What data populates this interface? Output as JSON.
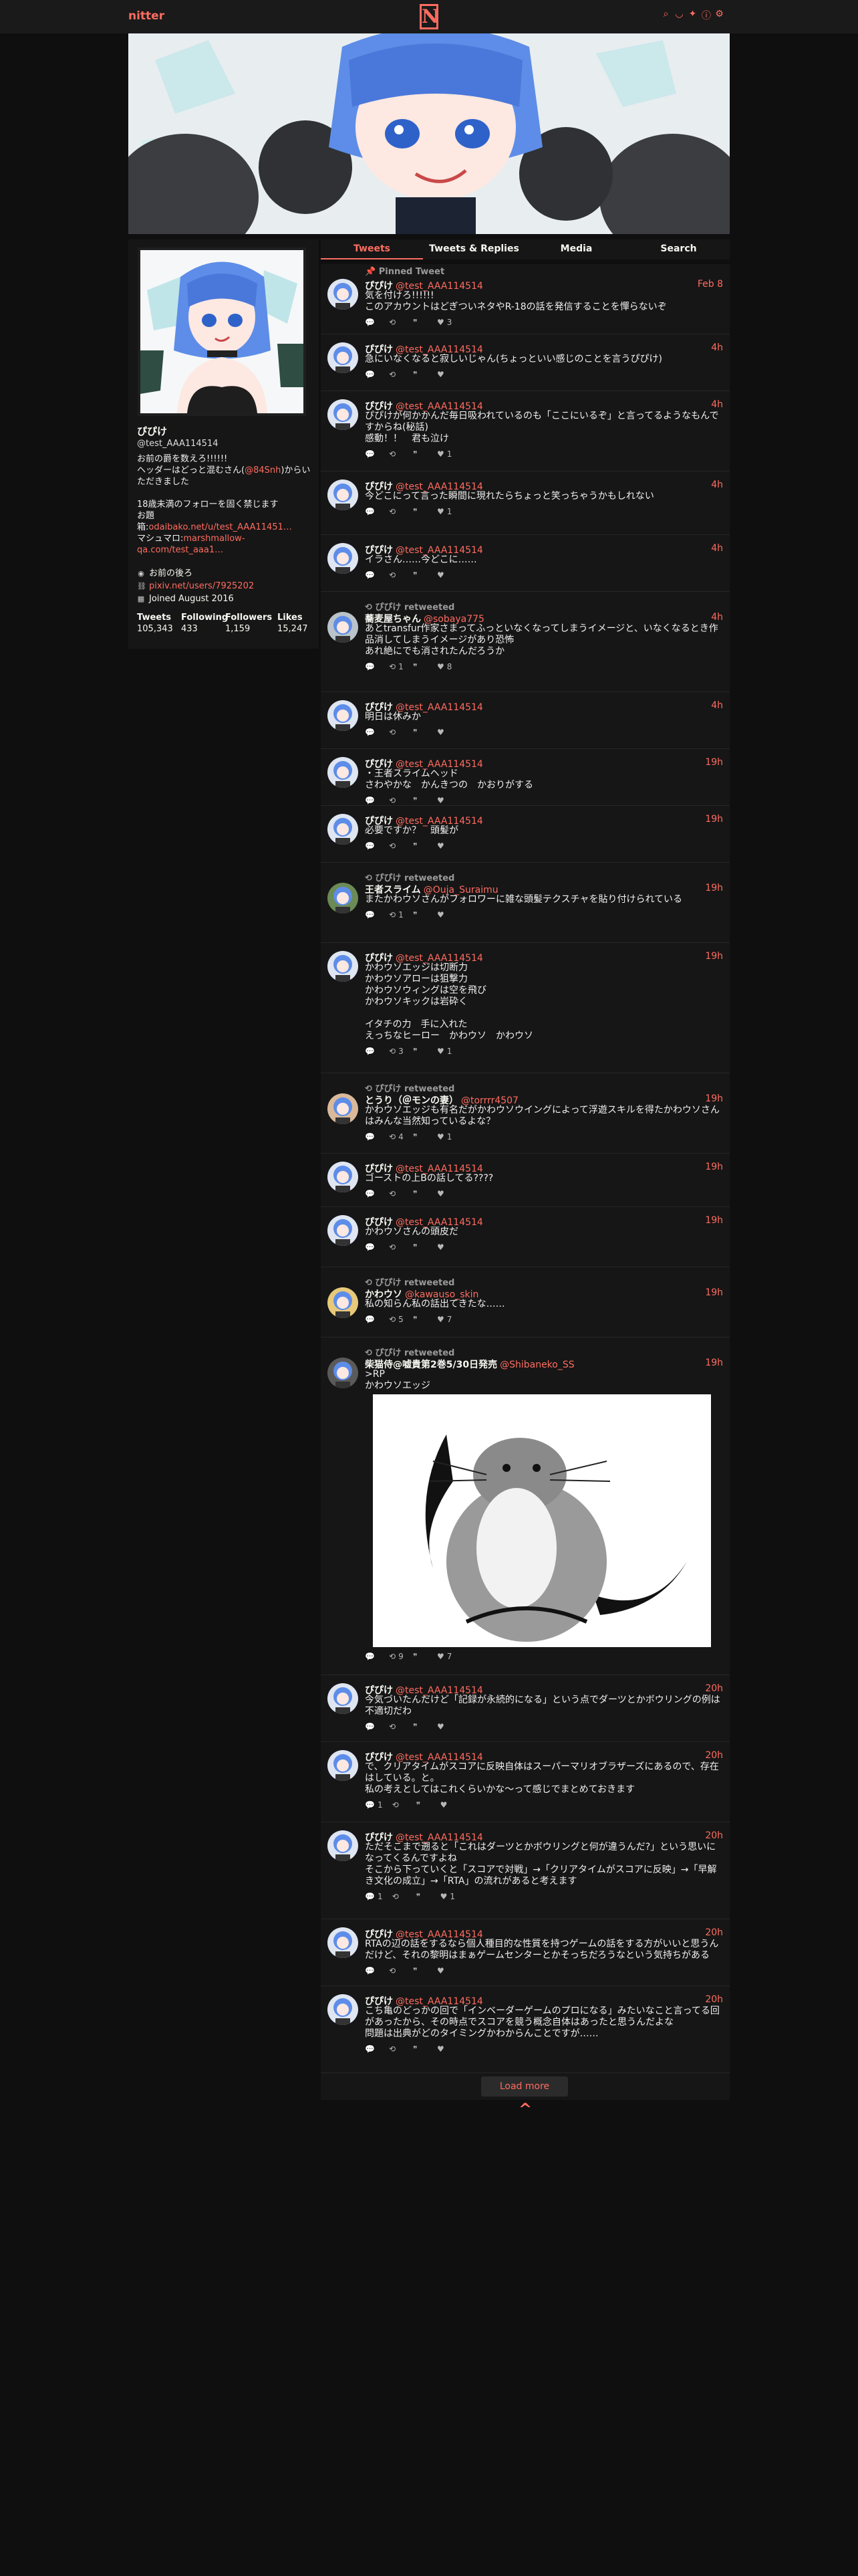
{
  "nav": {
    "logo": "nitter",
    "center_glyph": "N",
    "icons": [
      "search-icon",
      "rss-icon",
      "twitter-bird-icon",
      "info-icon",
      "settings-icon"
    ]
  },
  "profile": {
    "name": "ぴぴけ",
    "handle": "@test_AAA114514",
    "bio_line1_prefix": "お前の爵を数えろ!!!!!!",
    "bio_line2_prefix": "ヘッダーはどっと混むさん(",
    "bio_line2_link": "@84Snh",
    "bio_line2_suffix": ")からいただきました",
    "bio_line3": "18歳未満のフォローを固く禁じます",
    "bio_line4": "お題",
    "bio_line5_prefix": "箱:",
    "bio_line5_link": "odaibako.net/u/test_AAA11451…",
    "bio_line6_prefix": "マシュマロ:",
    "bio_line6_link": "marshmallow-qa.com/test_aaa1…",
    "location": "お前の後ろ",
    "website": "pixiv.net/users/7925202",
    "joined": "Joined August 2016",
    "stats": [
      {
        "label": "Tweets",
        "value": "105,343"
      },
      {
        "label": "Following",
        "value": "433"
      },
      {
        "label": "Followers",
        "value": "1,159"
      },
      {
        "label": "Likes",
        "value": "15,247"
      }
    ]
  },
  "tabs": [
    "Tweets",
    "Tweets & Replies",
    "Media",
    "Search"
  ],
  "pinned_label": "Pinned Tweet",
  "tweets": [
    {
      "retweet": "",
      "fullname": "ぴぴけ",
      "user": "@test_AAA114514",
      "date": "Feb 8",
      "text": "気を付けろ!!!!!!\nこのアカウントはどぎついネタやR-18の話を発信することを憚らないぞ",
      "replies": "",
      "retweets": "",
      "quotes": "",
      "likes": "3"
    },
    {
      "retweet": "",
      "fullname": "ぴぴけ",
      "user": "@test_AAA114514",
      "date": "4h",
      "text": "急にいなくなると寂しいじゃん(ちょっといい感じのことを言うぴぴけ)",
      "replies": "",
      "retweets": "",
      "quotes": "",
      "likes": ""
    },
    {
      "retweet": "",
      "fullname": "ぴぴけ",
      "user": "@test_AAA114514",
      "date": "4h",
      "text": "ぴぴけが何かかんだ毎日吸われているのも「ここにいるぞ」と言ってるようなもんですからね(秘話)\n感動！！　君も泣け",
      "replies": "",
      "retweets": "",
      "quotes": "",
      "likes": "1"
    },
    {
      "retweet": "",
      "fullname": "ぴぴけ",
      "user": "@test_AAA114514",
      "date": "4h",
      "text": "今どこにって言った瞬間に現れたらちょっと笑っちゃうかもしれない",
      "replies": "",
      "retweets": "",
      "quotes": "",
      "likes": "1"
    },
    {
      "retweet": "",
      "fullname": "ぴぴけ",
      "user": "@test_AAA114514",
      "date": "4h",
      "text": "イラさん……今どこに……",
      "replies": "",
      "retweets": "",
      "quotes": "",
      "likes": ""
    },
    {
      "retweet": "ぴぴけ retweeted",
      "fullname": "蕎麦屋ちゃん",
      "user": "@sobaya775",
      "date": "4h",
      "text": "あとtransfur作家さまってふっといなくなってしまうイメージと、いなくなるとき作品消してしまうイメージがあり恐怖\nあれ絶にでも消されたんだろうか",
      "replies": "",
      "retweets": "1",
      "quotes": "",
      "likes": "8"
    },
    {
      "retweet": "",
      "fullname": "ぴぴけ",
      "user": "@test_AAA114514",
      "date": "4h",
      "text": "明日は休みか",
      "replies": "",
      "retweets": "",
      "quotes": "",
      "likes": ""
    },
    {
      "retweet": "",
      "fullname": "ぴぴけ",
      "user": "@test_AAA114514",
      "date": "19h",
      "text": "・王者スライムヘッド\nさわやかな　かんきつの　かおりがする",
      "replies": "",
      "retweets": "",
      "quotes": "",
      "likes": ""
    },
    {
      "retweet": "",
      "fullname": "ぴぴけ",
      "user": "@test_AAA114514",
      "date": "19h",
      "text": "必要ですか？　頭髪が",
      "replies": "",
      "retweets": "",
      "quotes": "",
      "likes": ""
    },
    {
      "retweet": "ぴぴけ retweeted",
      "fullname": "王者スライム",
      "user": "@Ouja_Suraimu",
      "date": "19h",
      "text": "またかわウソさんがフォロワーに雑な頭髪テクスチャを貼り付けられている",
      "replies": "",
      "retweets": "1",
      "quotes": "",
      "likes": ""
    },
    {
      "retweet": "",
      "fullname": "ぴぴけ",
      "user": "@test_AAA114514",
      "date": "19h",
      "text": "かわウソエッジは切断力\nかわウソアローは狙撃力\nかわウソウィングは空を飛び\nかわウソキックは岩砕く\n\nイタチの力　手に入れた\nえっちなヒーロー　かわウソ　かわウソ",
      "replies": "",
      "retweets": "3",
      "quotes": "",
      "likes": "1"
    },
    {
      "retweet": "ぴぴけ retweeted",
      "fullname": "とうり（＠モンの妻）",
      "user": "@torrrr4507",
      "date": "19h",
      "text": "かわウソエッジも有名だがかわウソウイングによって浮遊スキルを得たかわウソさんはみんな当然知っているよな？",
      "replies": "",
      "retweets": "4",
      "quotes": "",
      "likes": "1"
    },
    {
      "retweet": "",
      "fullname": "ぴぴけ",
      "user": "@test_AAA114514",
      "date": "19h",
      "text": "ゴーストの上Bの話してる????",
      "replies": "",
      "retweets": "",
      "quotes": "",
      "likes": ""
    },
    {
      "retweet": "",
      "fullname": "ぴぴけ",
      "user": "@test_AAA114514",
      "date": "19h",
      "text": "かわウソさんの頭皮だ",
      "replies": "",
      "retweets": "",
      "quotes": "",
      "likes": ""
    },
    {
      "retweet": "ぴぴけ retweeted",
      "fullname": "かわウソ",
      "user": "@kawauso_skin",
      "date": "19h",
      "text": "私の知らん私の話出てきたな……",
      "replies": "",
      "retweets": "5",
      "quotes": "",
      "likes": "7"
    },
    {
      "retweet": "ぴぴけ retweeted",
      "fullname": "柴猫侍@嘘貴第2巻5/30日発売",
      "user": "@Shibaneko_SS",
      "date": "19h",
      "text": ">RP\nかわウソエッジ",
      "replies": "",
      "retweets": "9",
      "quotes": "",
      "likes": "7"
    },
    {
      "retweet": "",
      "fullname": "ぴぴけ",
      "user": "@test_AAA114514",
      "date": "20h",
      "text": "今気づいたんだけど「記録が永続的になる」という点でダーツとかボウリングの例は不適切だわ",
      "replies": "",
      "retweets": "",
      "quotes": "",
      "likes": ""
    },
    {
      "retweet": "",
      "fullname": "ぴぴけ",
      "user": "@test_AAA114514",
      "date": "20h",
      "text": "で、クリアタイムがスコアに反映自体はスーパーマリオブラザーズにあるので、存在はしている。と。\n私の考えとしてはこれくらいかな〜って感じでまとめておきます",
      "replies": "1",
      "retweets": "",
      "quotes": "",
      "likes": ""
    },
    {
      "retweet": "",
      "fullname": "ぴぴけ",
      "user": "@test_AAA114514",
      "date": "20h",
      "text": "ただそこまで遡ると「これはダーツとかボウリングと何が違うんだ?」という思いになってくるんですよね\nそこから下っていくと「スコアで対戦」→「クリアタイムがスコアに反映」→「早解き文化の成立」→「RTA」の流れがあると考えます",
      "replies": "1",
      "retweets": "",
      "quotes": "",
      "likes": "1"
    },
    {
      "retweet": "",
      "fullname": "ぴぴけ",
      "user": "@test_AAA114514",
      "date": "20h",
      "text": "RTAの辺の話をするなら個人種目的な性質を持つゲームの話をする方がいいと思うんだけど、それの黎明はまぁゲームセンターとかそっちだろうなという気持ちがある",
      "replies": "",
      "retweets": "",
      "quotes": "",
      "likes": ""
    },
    {
      "retweet": "",
      "fullname": "ぴぴけ",
      "user": "@test_AAA114514",
      "date": "20h",
      "text": "こち亀のどっかの回で「インベーダーゲームのプロになる」みたいなこと言ってる回があったから、その時点でスコアを競う概念自体はあったと思うんだよな\n問題は出典がどのタイミングかわからんことですが……",
      "replies": "",
      "retweets": "",
      "quotes": "",
      "likes": ""
    }
  ],
  "load_more": "Load more",
  "go_top": "^",
  "colors": {
    "accent": "#ff6c60",
    "background": "#0f0f0f",
    "panel": "#161616",
    "text": "#f8f8f2"
  }
}
